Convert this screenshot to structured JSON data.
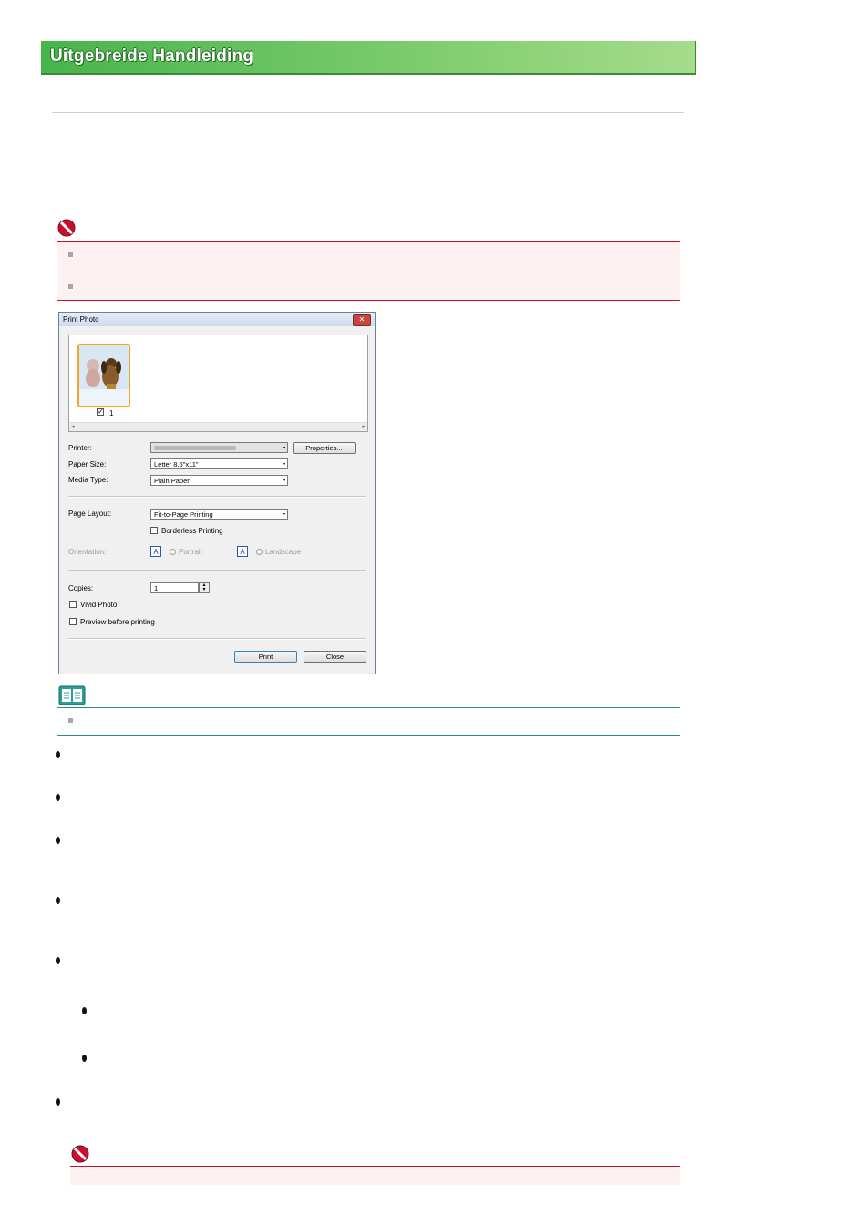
{
  "header": {
    "title": "Uitgebreide Handleiding"
  },
  "dialog": {
    "title": "Print Photo",
    "close_symbol": "✕",
    "thumbnail_number": "1",
    "printer_label": "Printer:",
    "printer_value": "",
    "properties_button": "Properties...",
    "paper_size_label": "Paper Size:",
    "paper_size_value": "Letter 8.5\"x11\"",
    "media_type_label": "Media Type:",
    "media_type_value": "Plain Paper",
    "page_layout_label": "Page Layout:",
    "page_layout_value": "Fit-to-Page Printing",
    "borderless_label": "Borderless Printing",
    "orientation_label": "Orientation:",
    "portrait_label": "Portrait",
    "landscape_label": "Landscape",
    "orientation_icon_letter": "A",
    "copies_label": "Copies:",
    "copies_value": "1",
    "vivid_photo_label": "Vivid Photo",
    "preview_label": "Preview before printing",
    "print_button": "Print",
    "close_button": "Close",
    "scroll_left": "◂",
    "scroll_right": "▸",
    "combo_arrow": "▾",
    "spin_up": "▴",
    "spin_down": "▾",
    "checkmark": "✓"
  },
  "colors": {
    "banner_green": "#46b54a",
    "caution_red": "#c8102e",
    "note_teal": "#2c8c8c",
    "thumbnail_border": "#f6a623"
  }
}
